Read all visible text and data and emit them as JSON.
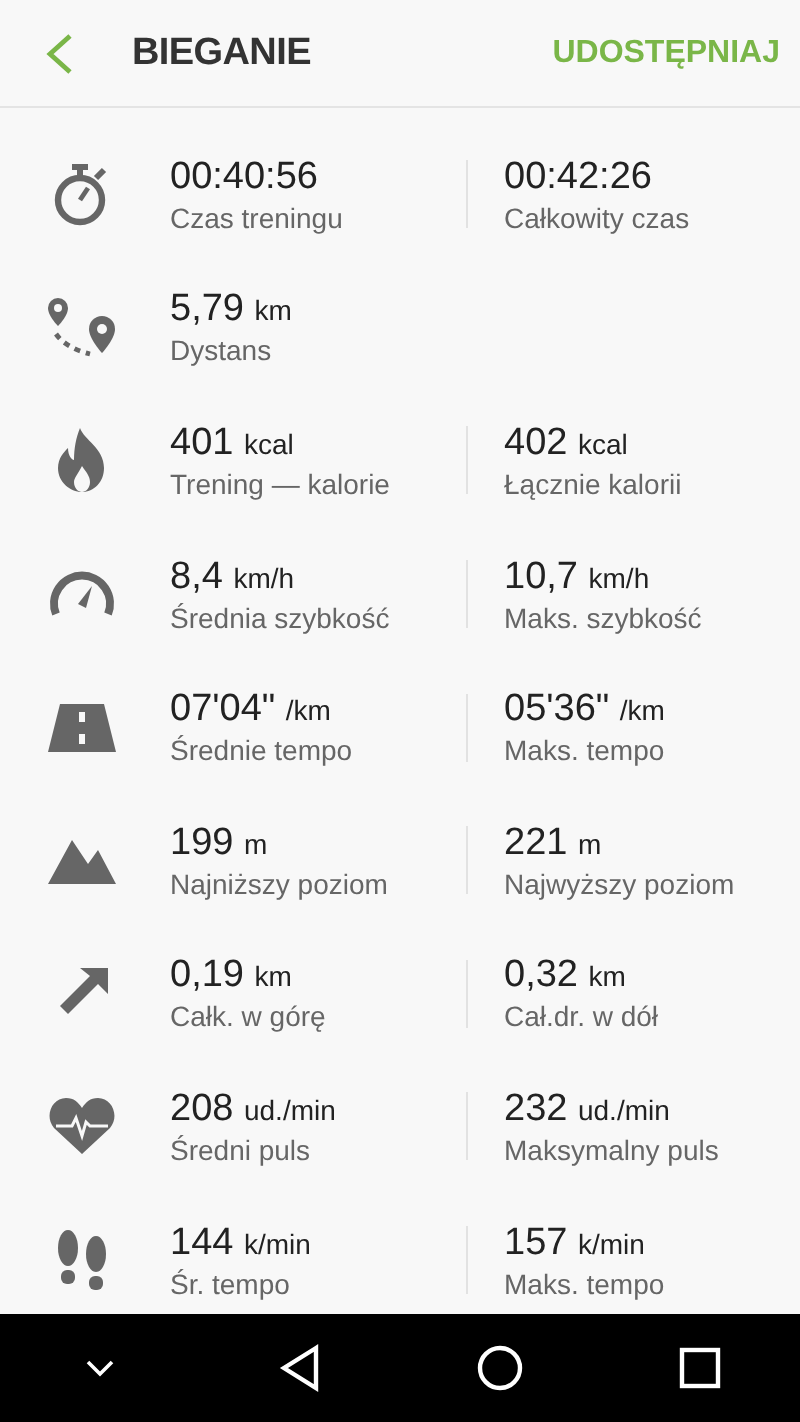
{
  "header": {
    "title": "BIEGANIE",
    "action": "UDOSTĘPNIAJ"
  },
  "stats": [
    {
      "cells": [
        {
          "value": "00:40:56",
          "label": "Czas treningu"
        },
        {
          "value": "00:42:26",
          "label": "Całkowity czas"
        }
      ]
    },
    {
      "cells": [
        {
          "value": "5,79",
          "unit": "km",
          "label": "Dystans"
        }
      ]
    },
    {
      "cells": [
        {
          "value": "401",
          "unit": "kcal",
          "label": "Trening — kalorie"
        },
        {
          "value": "402",
          "unit": "kcal",
          "label": "Łącznie kalorii"
        }
      ]
    },
    {
      "cells": [
        {
          "value": "8,4",
          "unit": "km/h",
          "label": "Średnia szybkość"
        },
        {
          "value": "10,7",
          "unit": "km/h",
          "label": "Maks. szybkość"
        }
      ]
    },
    {
      "cells": [
        {
          "value": "07'04\"",
          "unit": "/km",
          "label": "Średnie tempo"
        },
        {
          "value": "05'36\"",
          "unit": "/km",
          "label": "Maks. tempo"
        }
      ]
    },
    {
      "cells": [
        {
          "value": "199",
          "unit": "m",
          "label": "Najniższy poziom"
        },
        {
          "value": "221",
          "unit": "m",
          "label": "Najwyższy poziom"
        }
      ]
    },
    {
      "cells": [
        {
          "value": "0,19",
          "unit": "km",
          "label": "Całk. w górę"
        },
        {
          "value": "0,32",
          "unit": "km",
          "label": "Cał.dr. w dół"
        }
      ]
    },
    {
      "cells": [
        {
          "value": "208",
          "unit": "ud./min",
          "label": "Średni puls"
        },
        {
          "value": "232",
          "unit": "ud./min",
          "label": "Maksymalny puls"
        }
      ]
    },
    {
      "cells": [
        {
          "value": "144",
          "unit": "k/min",
          "label": "Śr. tempo"
        },
        {
          "value": "157",
          "unit": "k/min",
          "label": "Maks. tempo"
        }
      ]
    }
  ]
}
